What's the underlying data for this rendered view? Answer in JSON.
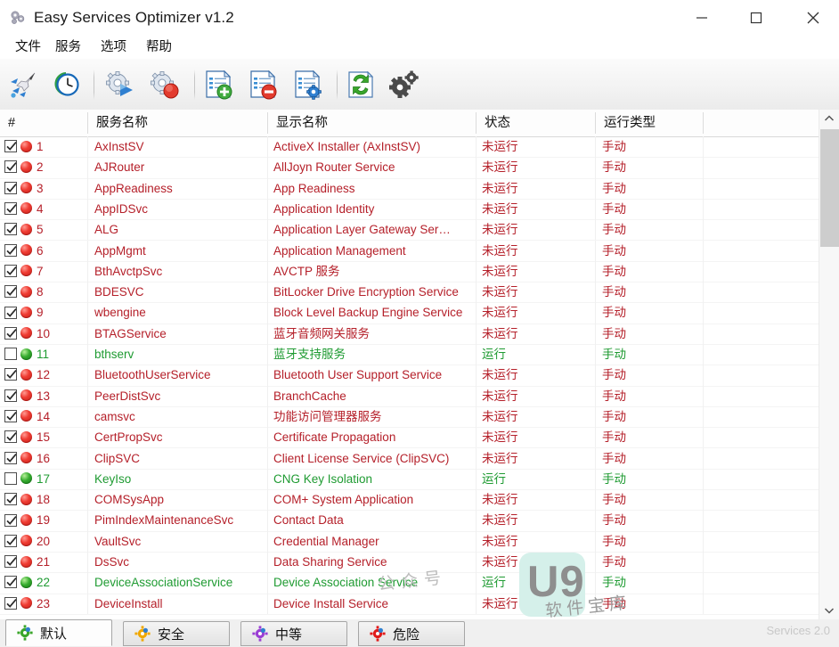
{
  "window": {
    "title": "Easy Services Optimizer v1.2",
    "app_icon": "gear-cluster-icon",
    "minimize_label": "—",
    "maximize_label": "□",
    "close_label": "✕"
  },
  "menu": {
    "items": [
      {
        "label": "文件",
        "name": "menu-file"
      },
      {
        "label": "服务",
        "name": "menu-service"
      },
      {
        "label": "选项",
        "name": "menu-options"
      },
      {
        "label": "帮助",
        "name": "menu-help"
      }
    ]
  },
  "toolbar": {
    "buttons": [
      {
        "name": "optimize-icon",
        "tip": "optimize"
      },
      {
        "name": "restore-clock-icon",
        "tip": "restore"
      },
      {
        "name": "start-service-icon",
        "tip": "start service"
      },
      {
        "name": "stop-service-icon",
        "tip": "stop service"
      },
      {
        "name": "add-list-icon",
        "tip": "add"
      },
      {
        "name": "remove-list-icon",
        "tip": "remove"
      },
      {
        "name": "edit-list-icon",
        "tip": "edit"
      },
      {
        "name": "refresh-icon",
        "tip": "refresh"
      },
      {
        "name": "settings-gears-icon",
        "tip": "settings"
      }
    ]
  },
  "table": {
    "columns": [
      {
        "label": "#",
        "name": "column-index"
      },
      {
        "label": "服务名称",
        "name": "column-service-name"
      },
      {
        "label": "显示名称",
        "name": "column-display-name"
      },
      {
        "label": "状态",
        "name": "column-status"
      },
      {
        "label": "运行类型",
        "name": "column-startup-type"
      }
    ],
    "state_stopped": "未运行",
    "state_running": "运行",
    "type_manual": "手动",
    "color_stopped": "#b5202a",
    "color_running": "#1f9b32",
    "rows": [
      {
        "num": "1",
        "checked": true,
        "running": false,
        "service": "AxInstSV",
        "display": "ActiveX Installer (AxInstSV)",
        "state": "未运行",
        "type": "手动"
      },
      {
        "num": "2",
        "checked": true,
        "running": false,
        "service": "AJRouter",
        "display": "AllJoyn Router Service",
        "state": "未运行",
        "type": "手动"
      },
      {
        "num": "3",
        "checked": true,
        "running": false,
        "service": "AppReadiness",
        "display": "App Readiness",
        "state": "未运行",
        "type": "手动"
      },
      {
        "num": "4",
        "checked": true,
        "running": false,
        "service": "AppIDSvc",
        "display": "Application Identity",
        "state": "未运行",
        "type": "手动"
      },
      {
        "num": "5",
        "checked": true,
        "running": false,
        "service": "ALG",
        "display": "Application Layer Gateway Ser…",
        "state": "未运行",
        "type": "手动"
      },
      {
        "num": "6",
        "checked": true,
        "running": false,
        "service": "AppMgmt",
        "display": "Application Management",
        "state": "未运行",
        "type": "手动"
      },
      {
        "num": "7",
        "checked": true,
        "running": false,
        "service": "BthAvctpSvc",
        "display": "AVCTP 服务",
        "state": "未运行",
        "type": "手动"
      },
      {
        "num": "8",
        "checked": true,
        "running": false,
        "service": "BDESVC",
        "display": "BitLocker Drive Encryption Service",
        "state": "未运行",
        "type": "手动"
      },
      {
        "num": "9",
        "checked": true,
        "running": false,
        "service": "wbengine",
        "display": "Block Level Backup Engine Service",
        "state": "未运行",
        "type": "手动"
      },
      {
        "num": "10",
        "checked": true,
        "running": false,
        "service": "BTAGService",
        "display": "蓝牙音频网关服务",
        "state": "未运行",
        "type": "手动"
      },
      {
        "num": "11",
        "checked": false,
        "running": true,
        "service": "bthserv",
        "display": "蓝牙支持服务",
        "state": "运行",
        "type": "手动"
      },
      {
        "num": "12",
        "checked": true,
        "running": false,
        "service": "BluetoothUserService",
        "display": "Bluetooth User Support Service",
        "state": "未运行",
        "type": "手动"
      },
      {
        "num": "13",
        "checked": true,
        "running": false,
        "service": "PeerDistSvc",
        "display": "BranchCache",
        "state": "未运行",
        "type": "手动"
      },
      {
        "num": "14",
        "checked": true,
        "running": false,
        "service": "camsvc",
        "display": "功能访问管理器服务",
        "state": "未运行",
        "type": "手动"
      },
      {
        "num": "15",
        "checked": true,
        "running": false,
        "service": "CertPropSvc",
        "display": "Certificate Propagation",
        "state": "未运行",
        "type": "手动"
      },
      {
        "num": "16",
        "checked": true,
        "running": false,
        "service": "ClipSVC",
        "display": "Client License Service (ClipSVC)",
        "state": "未运行",
        "type": "手动"
      },
      {
        "num": "17",
        "checked": false,
        "running": true,
        "service": "KeyIso",
        "display": "CNG Key Isolation",
        "state": "运行",
        "type": "手动"
      },
      {
        "num": "18",
        "checked": true,
        "running": false,
        "service": "COMSysApp",
        "display": "COM+ System Application",
        "state": "未运行",
        "type": "手动"
      },
      {
        "num": "19",
        "checked": true,
        "running": false,
        "service": "PimIndexMaintenanceSvc",
        "display": "Contact Data",
        "state": "未运行",
        "type": "手动"
      },
      {
        "num": "20",
        "checked": true,
        "running": false,
        "service": "VaultSvc",
        "display": "Credential Manager",
        "state": "未运行",
        "type": "手动"
      },
      {
        "num": "21",
        "checked": true,
        "running": false,
        "service": "DsSvc",
        "display": "Data Sharing Service",
        "state": "未运行",
        "type": "手动"
      },
      {
        "num": "22",
        "checked": true,
        "running": true,
        "service": "DeviceAssociationService",
        "display": "Device Association Service",
        "state": "运行",
        "type": "手动"
      },
      {
        "num": "23",
        "checked": true,
        "running": false,
        "service": "DeviceInstall",
        "display": "Device Install Service",
        "state": "未运行",
        "type": "手动"
      }
    ]
  },
  "scrollbar": {
    "up_icon": "chevron-up-icon",
    "down_icon": "chevron-down-icon"
  },
  "tabs": [
    {
      "label": "默认",
      "name": "tab-default",
      "icon": "gear-icon",
      "color": "#3aa62b",
      "active": true
    },
    {
      "label": "安全",
      "name": "tab-safe",
      "icon": "gear-icon",
      "color": "#f0a800",
      "active": false
    },
    {
      "label": "中等",
      "name": "tab-medium",
      "icon": "gear-icon",
      "color": "#9b3fd4",
      "active": false
    },
    {
      "label": "危险",
      "name": "tab-dangerous",
      "icon": "gear-icon",
      "color": "#e01b1b",
      "active": false
    }
  ],
  "statusbar": {
    "text": "Services 2.0"
  },
  "watermark": {
    "top_text": "公众号",
    "logo": "U9",
    "bottom_text": "软件宝库",
    "box_color": "#d5f0ea"
  }
}
